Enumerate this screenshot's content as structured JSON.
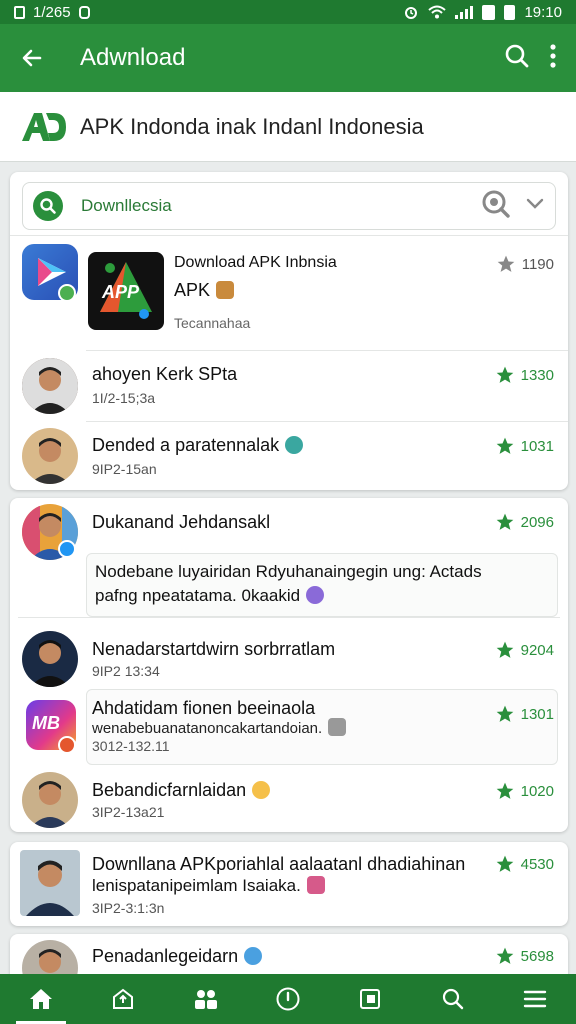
{
  "status_bar": {
    "left_text": "1/265",
    "time": "19:10"
  },
  "app_bar": {
    "title": "Adwnload"
  },
  "brand": {
    "text": "APK Indonda inak Indanl Indonesia"
  },
  "filter": {
    "label": "Downllecsia"
  },
  "featured": {
    "title": "Download APK Inbnsia",
    "subtitle": "APK",
    "meta": "Tecannahaa",
    "rating": "1190",
    "icon_text": "APP"
  },
  "rows_card1": [
    {
      "name": "ahoyen Kerk  SPta",
      "sub": "1I/2-15;3a",
      "rating": "1330"
    },
    {
      "name": "Dended a paratennalak",
      "sub": "9IP2-15an",
      "rating": "1031"
    }
  ],
  "card2": {
    "top": {
      "name": "Dukanand Jehdansakl",
      "rating": "2096"
    },
    "quote_line1": "Nodebane luyairidan Rdyuhanaingegin ung: Actads",
    "quote_line2": "pafng npeatatama. 0kaakid",
    "rows": [
      {
        "name": "Nenadarstartdwirn sorbrratlam",
        "sub": "9IP2 13:34",
        "rating": "9204"
      },
      {
        "name": "Ahdatidam fionen beeinaola",
        "sub2": "wenabebuanatanoncakartandoian.",
        "sub": "3012-132.11",
        "rating": "1301",
        "icon_text": "MB"
      },
      {
        "name": "Bebandicfarnlaidan",
        "sub": "3IP2-13a21",
        "rating": "1020"
      }
    ]
  },
  "card3": {
    "name": "Downllana APKporiahlal aalaatanl dhadiahinan",
    "line2": "lenispatanipeimlam Isaiaka.",
    "sub": "3IP2-3:1:3n",
    "rating": "4530"
  },
  "card4": {
    "name": "Penadanlegeidarn",
    "rating": "5698"
  },
  "colors": {
    "primary": "#2a8f3c",
    "primary_dark": "#1f7a30"
  },
  "icons": [
    "back-arrow-icon",
    "search-icon",
    "more-vert-icon",
    "home-icon",
    "apps-icon",
    "groups-icon",
    "compass-icon",
    "bookmark-icon",
    "search-icon",
    "menu-icon",
    "star-icon"
  ]
}
